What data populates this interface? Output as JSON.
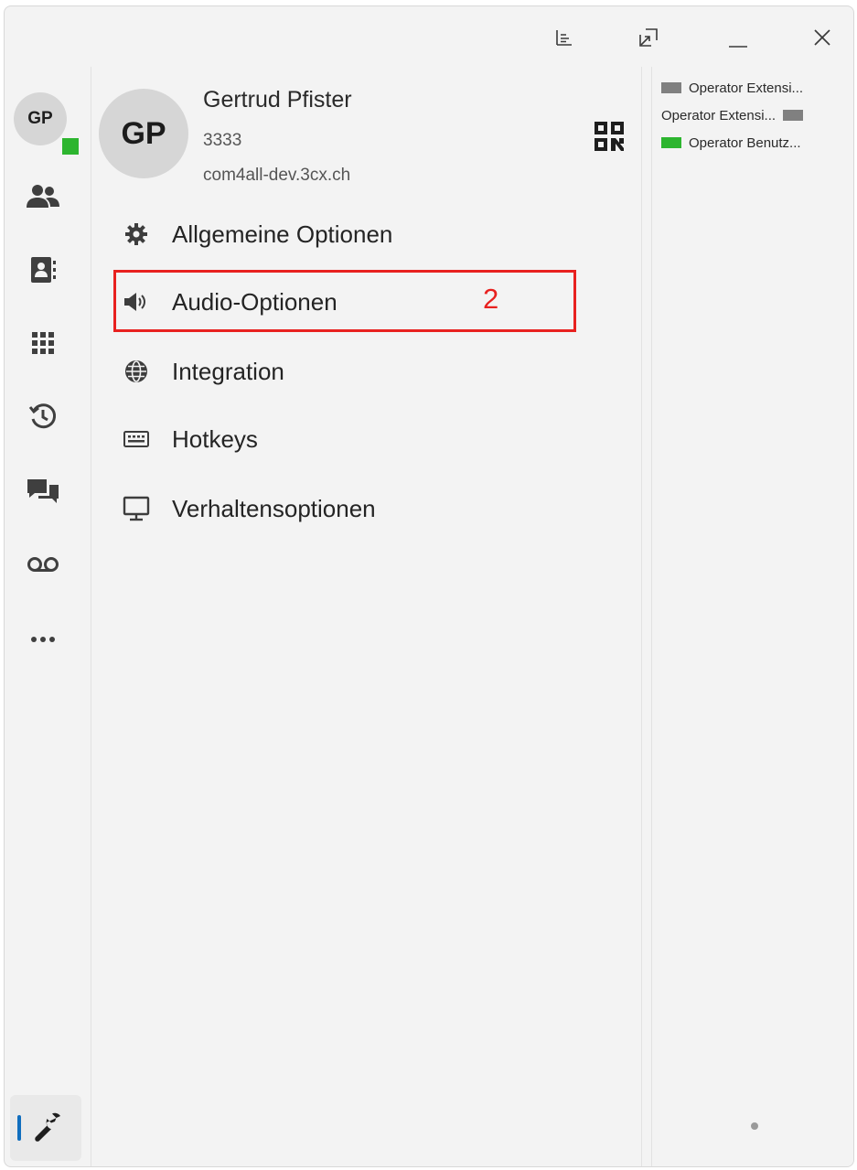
{
  "window": {
    "title_buttons": [
      {
        "icon": "list-view-icon"
      },
      {
        "icon": "pop-out-icon"
      },
      {
        "icon": "minimize-icon"
      },
      {
        "icon": "close-icon"
      }
    ]
  },
  "rail": {
    "user_initials": "GP",
    "presence_color": "#2db52f",
    "items": [
      {
        "icon": "people-icon"
      },
      {
        "icon": "contacts-icon"
      },
      {
        "icon": "dialpad-icon"
      },
      {
        "icon": "history-icon"
      },
      {
        "icon": "chat-icon"
      },
      {
        "icon": "voicemail-icon"
      },
      {
        "icon": "more-icon"
      }
    ],
    "active_item_icon": "wrench-icon",
    "accent_color": "#106ebe"
  },
  "profile": {
    "initials": "GP",
    "name": "Gertrud Pfister",
    "extension": "3333",
    "domain": "com4all-dev.3cx.ch",
    "qr_icon": "qr-code-icon"
  },
  "menu": [
    {
      "label": "Allgemeine Optionen",
      "icon": "gear-icon"
    },
    {
      "label": "Audio-Optionen",
      "icon": "speaker-icon"
    },
    {
      "label": "Integration",
      "icon": "globe-icon"
    },
    {
      "label": "Hotkeys",
      "icon": "keyboard-icon"
    },
    {
      "label": "Verhaltensoptionen",
      "icon": "monitor-icon"
    }
  ],
  "annotation": {
    "number": "2",
    "color": "#e8211f"
  },
  "blf": [
    {
      "label": "Operator Extensi...",
      "status_color": "#808080",
      "square_position": "left"
    },
    {
      "label": "Operator Extensi...",
      "status_color": "#808080",
      "square_position": "right"
    },
    {
      "label": "Operator Benutz...",
      "status_color": "#2db52f",
      "square_position": "left"
    }
  ]
}
